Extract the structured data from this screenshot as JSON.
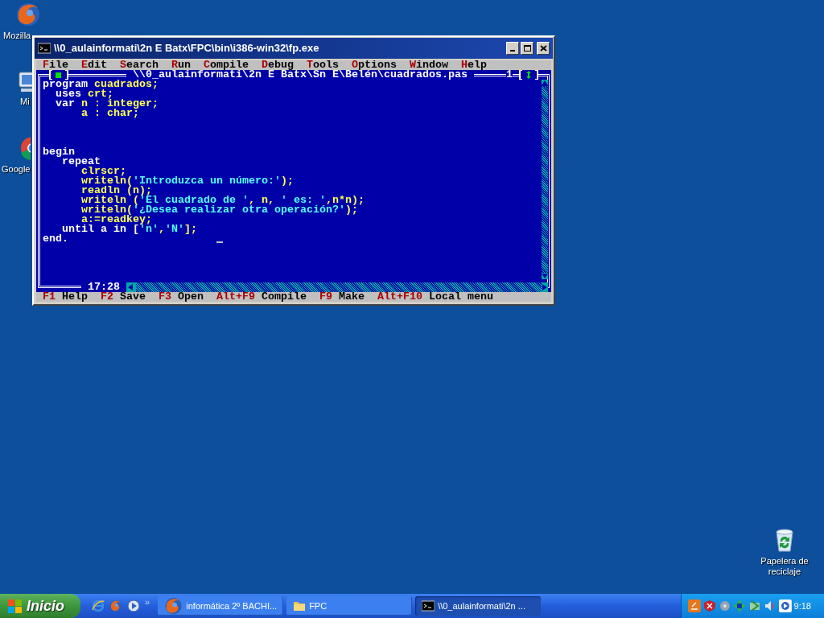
{
  "desktop_icons": [
    {
      "kind": "firefox",
      "label": "Mozilla"
    },
    {
      "kind": "computer",
      "label": "Mi"
    },
    {
      "kind": "chrome",
      "label": "Google"
    },
    {
      "kind": "recycle",
      "label": "Papelera de reciclaje"
    }
  ],
  "window": {
    "title": "\\\\0_aulainformati\\2n E Batx\\FPC\\bin\\i386-win32\\fp.exe"
  },
  "menu": [
    "File",
    "Edit",
    "Search",
    "Run",
    "Compile",
    "Debug",
    "Tools",
    "Options",
    "Window",
    "Help"
  ],
  "editor": {
    "title": "\\\\0_aulainformati\\2n E Batx\\Sn E\\Belén\\cuadrados.pas",
    "window_number": "1",
    "position": "17:28",
    "lines": [
      {
        "tokens": [
          {
            "text": "program",
            "kind": "keyword"
          },
          {
            "text": " cuadrados;",
            "kind": "ident"
          }
        ]
      },
      {
        "tokens": [
          {
            "text": "  uses",
            "kind": "keyword"
          },
          {
            "text": " crt;",
            "kind": "ident"
          }
        ]
      },
      {
        "tokens": [
          {
            "text": "  var",
            "kind": "keyword"
          },
          {
            "text": " n : integer;",
            "kind": "ident"
          }
        ]
      },
      {
        "tokens": [
          {
            "text": "      a : char;",
            "kind": "ident"
          }
        ]
      },
      {
        "kind": "blank"
      },
      {
        "kind": "blank"
      },
      {
        "kind": "blank"
      },
      {
        "tokens": [
          {
            "text": "begin",
            "kind": "keyword"
          }
        ]
      },
      {
        "tokens": [
          {
            "text": "   repeat",
            "kind": "keyword"
          }
        ]
      },
      {
        "tokens": [
          {
            "text": "      clrscr;",
            "kind": "ident"
          }
        ]
      },
      {
        "tokens": [
          {
            "text": "      writeln(",
            "kind": "ident"
          },
          {
            "text": "'Introduzca un número:'",
            "kind": "string"
          },
          {
            "text": ");",
            "kind": "ident"
          }
        ]
      },
      {
        "tokens": [
          {
            "text": "      readln (n);",
            "kind": "ident"
          }
        ]
      },
      {
        "tokens": [
          {
            "text": "      writeln (",
            "kind": "ident"
          },
          {
            "text": "'El cuadrado de '",
            "kind": "string"
          },
          {
            "text": ", n, ",
            "kind": "ident"
          },
          {
            "text": "' es: '",
            "kind": "string"
          },
          {
            "text": ",n*n);",
            "kind": "ident"
          }
        ]
      },
      {
        "tokens": [
          {
            "text": "      writeln(",
            "kind": "ident"
          },
          {
            "text": "'¿Desea realizar otra operación?'",
            "kind": "string"
          },
          {
            "text": ");",
            "kind": "ident"
          }
        ]
      },
      {
        "tokens": [
          {
            "text": "      a:=readkey;",
            "kind": "ident"
          }
        ]
      },
      {
        "tokens": [
          {
            "text": "   until a in [",
            "kind": "keyword"
          },
          {
            "text": "'n'",
            "kind": "string"
          },
          {
            "text": ",",
            "kind": "ident"
          },
          {
            "text": "'N'",
            "kind": "string"
          },
          {
            "text": "];",
            "kind": "ident"
          }
        ]
      },
      {
        "tokens": [
          {
            "text": "end.",
            "kind": "keyword"
          }
        ],
        "cursor": true
      }
    ]
  },
  "function_keys": [
    {
      "key": "F1",
      "label": "Help"
    },
    {
      "key": "F2",
      "label": "Save"
    },
    {
      "key": "F3",
      "label": "Open"
    },
    {
      "key": "Alt+F9",
      "label": "Compile"
    },
    {
      "key": "F9",
      "label": "Make"
    },
    {
      "key": "Alt+F10",
      "label": "Local menu"
    }
  ],
  "taskbar": {
    "start": "Inicio",
    "quick_launch": [
      {
        "kind": "ie"
      },
      {
        "kind": "firefox"
      },
      {
        "kind": "media"
      }
    ],
    "chevron": "»",
    "tasks": [
      {
        "kind": "firefox",
        "label": "informática 2º BACHI...",
        "selected": false
      },
      {
        "kind": "folder",
        "label": "FPC",
        "selected": false
      },
      {
        "kind": "console",
        "label": "\\\\0_aulainformati\\2n ...",
        "selected": true
      }
    ],
    "clock": "9:18"
  }
}
